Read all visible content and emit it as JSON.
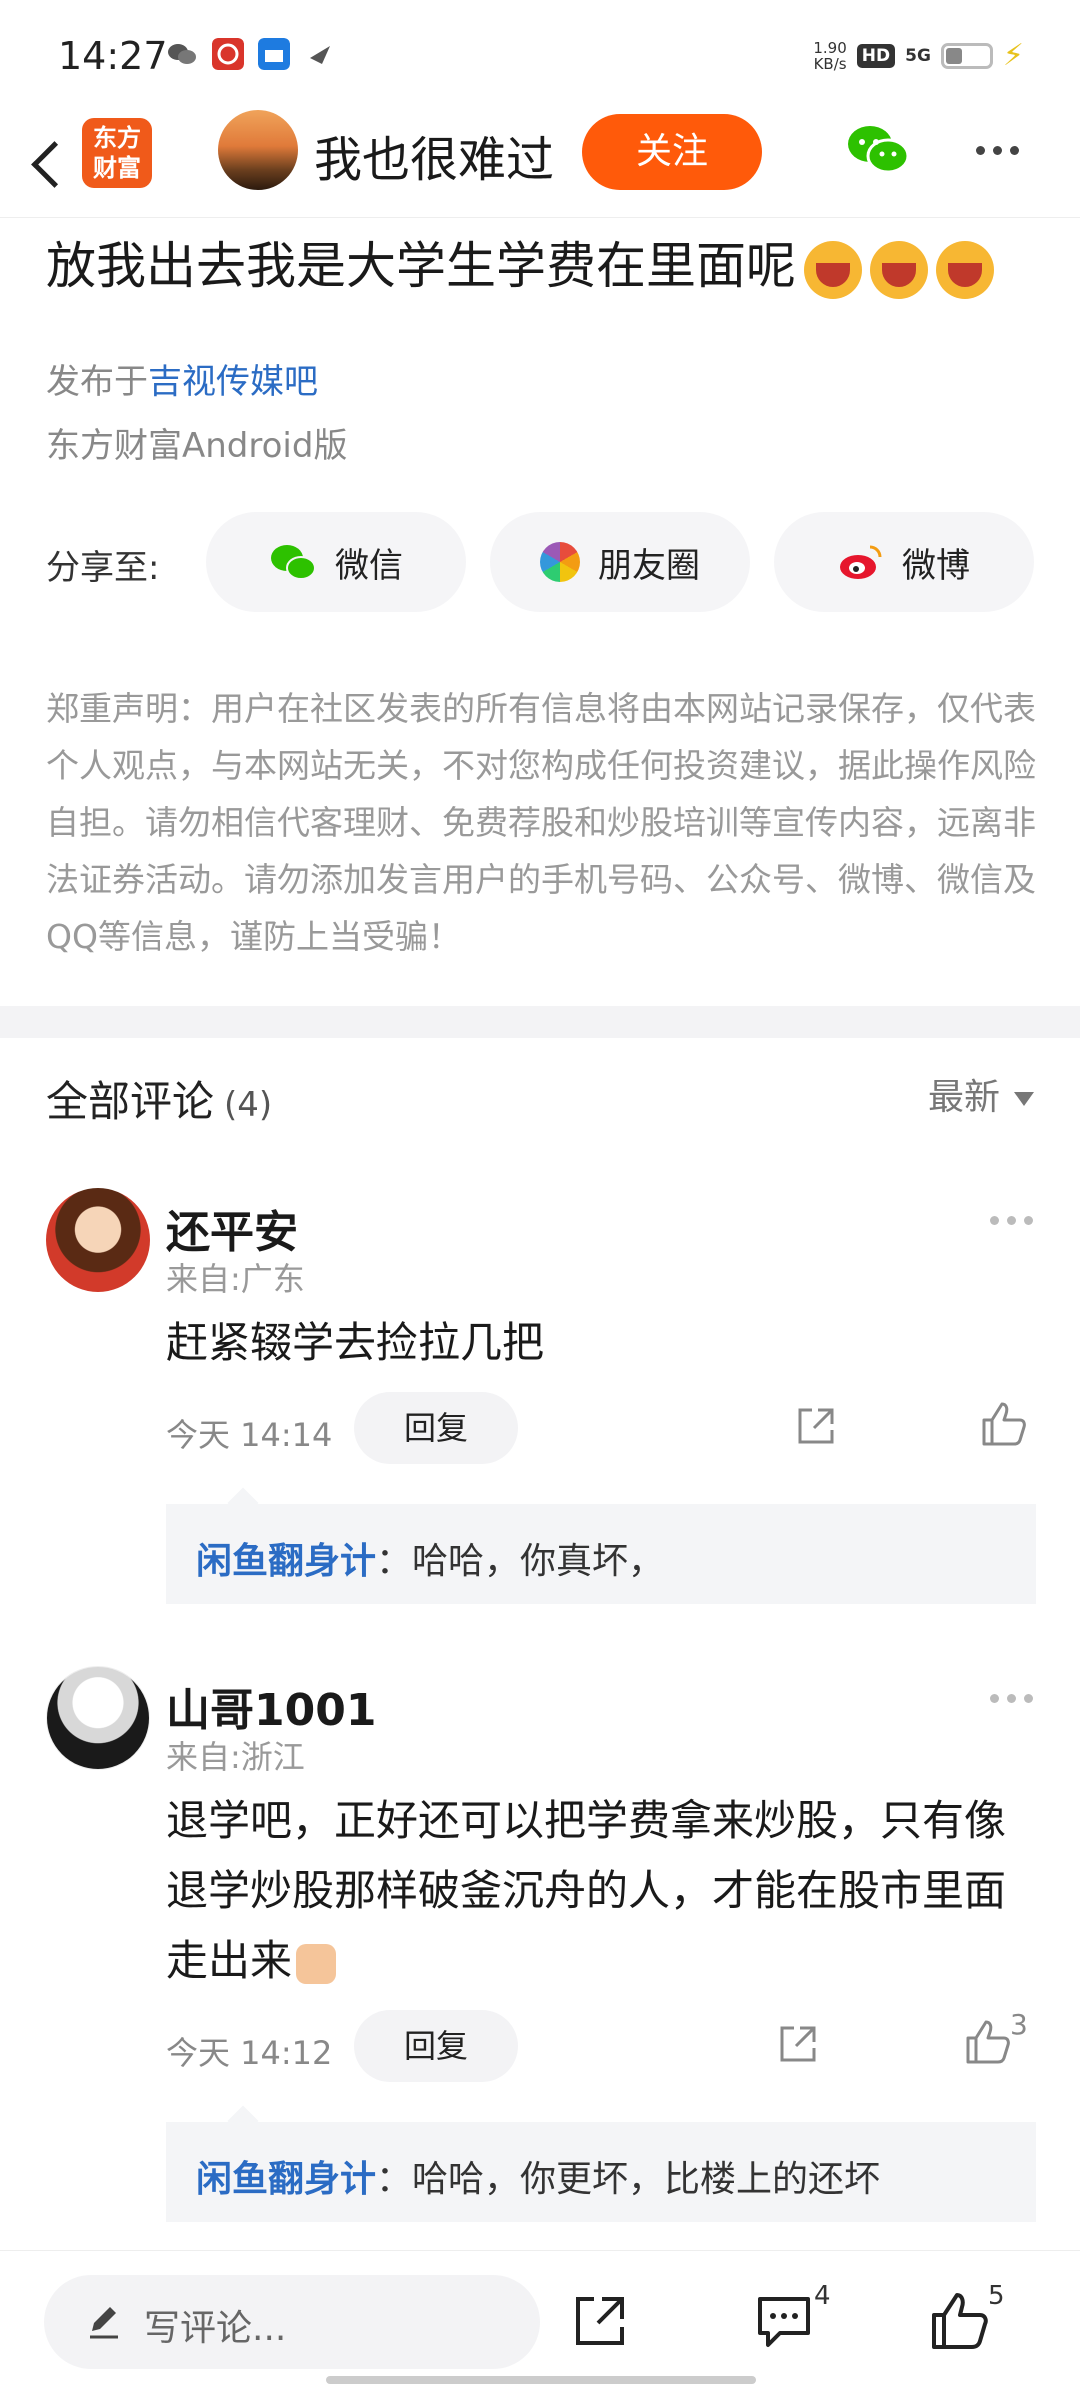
{
  "status_bar": {
    "time": "14:27",
    "net_speed_value": "1.90",
    "net_speed_unit": "KB/s",
    "hd": "HD",
    "signal": "5G"
  },
  "header": {
    "app_logo_line1": "东方",
    "app_logo_line2": "财富",
    "username": "我也很难过",
    "follow_label": "关注"
  },
  "post": {
    "title": "放我出去我是大学生学费在里面呢",
    "publish_prefix": "发布于",
    "publish_bar": "吉视传媒吧",
    "client": "东方财富Android版",
    "share_label": "分享至:",
    "share_wechat": "微信",
    "share_moments": "朋友圈",
    "share_weibo": "微博",
    "disclaimer": "郑重声明：用户在社区发表的所有信息将由本网站记录保存，仅代表个人观点，与本网站无关，不对您构成任何投资建议，据此操作风险自担。请勿相信代客理财、免费荐股和炒股培训等宣传内容，远离非法证券活动。请勿添加发言用户的手机号码、公众号、微博、微信及QQ等信息，谨防上当受骗！"
  },
  "comments_section": {
    "title": "全部评论",
    "count": "(4)",
    "sort": "最新"
  },
  "comments": [
    {
      "name": "还平安",
      "location": "来自:广东",
      "text": "赶紧辍学去捡拉几把",
      "time": "今天 14:14",
      "reply_label": "回复",
      "likes": "",
      "reply_author": "闲鱼翻身计",
      "reply_text": "：哈哈，你真坏，"
    },
    {
      "name": "山哥1001",
      "location": "来自:浙江",
      "text": "退学吧，正好还可以把学费拿来炒股，只有像退学炒股那样破釜沉舟的人，才能在股市里面走出来",
      "time": "今天 14:12",
      "reply_label": "回复",
      "likes": "3",
      "reply_author": "闲鱼翻身计",
      "reply_text": "：哈哈，你更坏，比楼上的还坏"
    }
  ],
  "bottom_bar": {
    "comment_placeholder": "写评论...",
    "comments_count": "4",
    "likes_count": "5"
  },
  "colors": {
    "accent": "#ff5a0a",
    "link": "#2b6cc4"
  }
}
